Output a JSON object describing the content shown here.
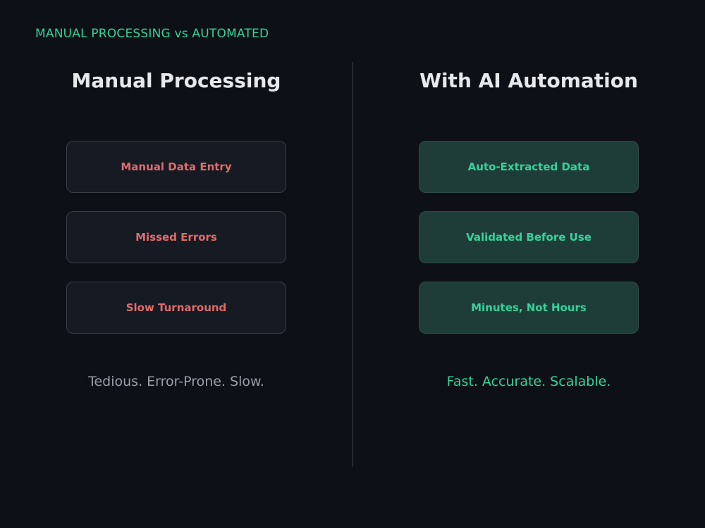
{
  "header": {
    "label": "MANUAL PROCESSING vs AUTOMATED"
  },
  "left": {
    "title": "Manual Processing",
    "items": [
      "Manual Data Entry",
      "Missed Errors",
      "Slow Turnaround"
    ],
    "tagline": "Tedious. Error-Prone. Slow."
  },
  "right": {
    "title": "With AI Automation",
    "items": [
      "Auto-Extracted Data",
      "Validated Before Use",
      "Minutes, Not Hours"
    ],
    "tagline": "Fast. Accurate. Scalable."
  },
  "colors": {
    "background": "#0d1017",
    "accent_green": "#34d399",
    "negative_red": "#e06c6c",
    "muted_gray": "#9aa0a9"
  }
}
